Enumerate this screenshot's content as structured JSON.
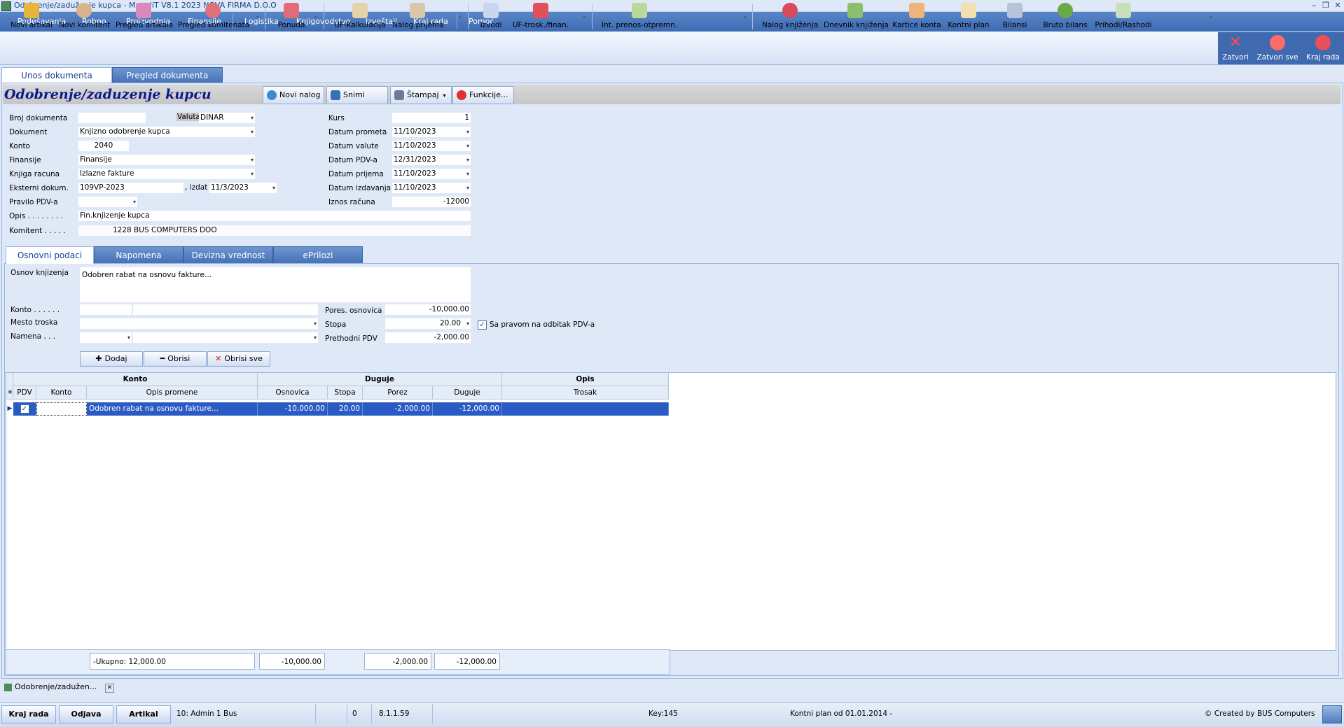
{
  "window": {
    "title": "Odobrenje/zaduženje kupca - MonoliT V8.1 2023 NOVA FIRMA D.O.O"
  },
  "menu": [
    "Podešavanja",
    "Robno",
    "Proizvodnja",
    "Finansije",
    "Logistika",
    "Knjigovodstvo",
    "Izveštaji",
    "Kraj rada",
    "Pomoć"
  ],
  "toolbar": {
    "novi_artikal": "Novi artikal",
    "novi_komitent": "Novi komitent",
    "pregled_artikala": "Pregled artikala",
    "pregled_komitenata": "Pregled komitenata",
    "ponuda": "Ponuda",
    "uf_kalkulacija": "UF-Kalkulacija",
    "nalog_prijema": "Nalog prijema",
    "izvodi": "Izvodi",
    "uf_trosk": "UF-trosk./finan.",
    "int_prenos": "Int. prenos-otpremn.",
    "nalog_knjizenja": "Nalog knjiženja",
    "dnevnik_knjizenja": "Dnevnik knjiženja",
    "kartice_konta": "Kartice konta",
    "kontni_plan": "Kontni plan",
    "bilansi": "Bilansi",
    "bruto_bilans": "Bruto bilans",
    "prihodi_rashodi": "Prihodi/Rashodi",
    "zatvori": "Zatvori",
    "zatvori_sve": "Zatvori sve",
    "kraj_rada": "Kraj rada"
  },
  "doc_tabs": {
    "unos": "Unos dokumenta",
    "pregled": "Pregled dokumenta"
  },
  "header": {
    "title": "Odobrenje/zaduzenje kupcu",
    "novi_nalog": "Novi nalog",
    "snimi": "Snimi",
    "stampaj": "Štampaj",
    "funkcije": "Funkcije..."
  },
  "form": {
    "broj_dokumenta_label": "Broj dokumenta",
    "broj_dokumenta": "",
    "valuta_label": "Valuta",
    "valuta": "DINAR",
    "dokument_label": "Dokument",
    "dokument": "Knjizno odobrenje kupca",
    "konto_label": "Konto",
    "konto": "2040",
    "finansije_label": "Finansije",
    "finansije": "Finansije",
    "knjiga_label": "Knjiga racuna",
    "knjiga": "Izlazne fakture",
    "eksterni_label": "Eksterni dokum.",
    "eksterni": "109VP-2023",
    "izdat_label": ", izdat",
    "izdat": "11/3/2023",
    "pravilo_label": "Pravilo PDV-a",
    "pravilo": "",
    "opis_label": "Opis . . . . . . . .",
    "opis": "Fin.knjizenje kupca",
    "komitent_label": "Komitent . . . . .",
    "komitent": "1228 BUS COMPUTERS DOO",
    "kurs_label": "Kurs",
    "kurs": "1",
    "datum_prometa_label": "Datum prometa",
    "datum_prometa": "11/10/2023",
    "datum_valute_label": "Datum valute",
    "datum_valute": "11/10/2023",
    "datum_pdv_label": "Datum PDV-a",
    "datum_pdv": "12/31/2023",
    "datum_prijema_label": "Datum prijema",
    "datum_prijema": "11/10/2023",
    "datum_izdavanja_label": "Datum izdavanja",
    "datum_izdavanja": "11/10/2023",
    "iznos_label": "Iznos računa",
    "iznos": "-12000"
  },
  "sub_tabs": [
    "Osnovni podaci",
    "Napomena",
    "Devizna vrednost",
    "ePrilozi"
  ],
  "osnovni": {
    "osnov_label": "Osnov knjizenja",
    "osnov": "Odobren rabat na osnovu fakture...",
    "konto_label": "Konto . . . . . .",
    "mesto_label": "Mesto troska",
    "namena_label": "Namena . . .",
    "pores_label": "Pores. osnovica",
    "pores": "-10,000.00",
    "stopa_label": "Stopa",
    "stopa": "20.00",
    "prethodni_label": "Prethodni PDV",
    "prethodni": "-2,000.00",
    "sa_pravom_label": "Sa pravom na odbitak PDV-a",
    "dodaj": "Dodaj",
    "obrisi": "Obrisi",
    "obrisi_sve": "Obrisi sve"
  },
  "grid": {
    "groups": [
      "Konto",
      "Duguje",
      "Opis"
    ],
    "columns": [
      "PDV",
      "Konto",
      "Opis promene",
      "Osnovica",
      "Stopa",
      "Porez",
      "Duguje",
      "Trosak"
    ],
    "row": {
      "pdv": "✓",
      "konto": "",
      "opis": "Odobren rabat na osnovu fakture...",
      "osnovica": "-10,000.00",
      "stopa": "20.00",
      "porez": "-2,000.00",
      "duguje": "-12,000.00",
      "trosak": ""
    },
    "footer": {
      "ukupno": "-Ukupno:  12,000.00",
      "osnovica": "-10,000.00",
      "porez": "-2,000.00",
      "duguje": "-12,000.00"
    }
  },
  "window_tab": "Odobrenje/zadužen...",
  "status": {
    "kraj_rada": "Kraj rada",
    "odjava": "Odjava",
    "artikal": "Artikal",
    "user": "10: Admin 1 Bus",
    "zero": "0",
    "version": "8.1.1.59",
    "key": "Key:145",
    "kontni_plan": "Kontni plan od 01.01.2014 -",
    "created": "© Created by BUS Computers"
  }
}
